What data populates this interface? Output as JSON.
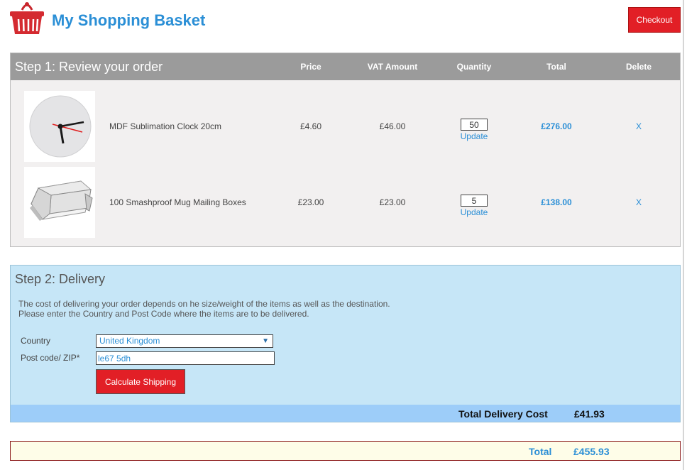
{
  "header": {
    "title": "My Shopping Basket",
    "checkout_label": "Checkout",
    "icon": "basket-icon"
  },
  "step1": {
    "title": "Step 1: Review your order",
    "columns": [
      "Price",
      "VAT Amount",
      "Quantity",
      "Total",
      "Delete"
    ],
    "items": [
      {
        "name": "MDF Sublimation Clock 20cm",
        "price": "£4.60",
        "vat": "£46.00",
        "quantity": "50",
        "update": "Update",
        "total": "£276.00",
        "delete": "X",
        "thumbnail": "clock-image"
      },
      {
        "name": "100 Smashproof Mug Mailing Boxes",
        "price": "£23.00",
        "vat": "£23.00",
        "quantity": "5",
        "update": "Update",
        "total": "£138.00",
        "delete": "X",
        "thumbnail": "mailing-box-image"
      }
    ]
  },
  "step2": {
    "title": "Step 2: Delivery",
    "desc_line1": "The cost of delivering your order depends on he size/weight of the items as well as the destination.",
    "desc_line2": "Please enter the Country and Post Code where the items are to be delivered.",
    "country_label": "Country",
    "country_value": "United Kingdom",
    "postcode_label": "Post code/ ZIP*",
    "postcode_value": "le67 5dh",
    "calc_label": "Calculate Shipping",
    "delivery_label": "Total Delivery Cost",
    "delivery_value": "£41.93"
  },
  "totals": {
    "label": "Total",
    "value": "£455.93"
  },
  "colors": {
    "accent_blue": "#2b8fd6",
    "button_red": "#e21f26",
    "step1_header": "#9b9b9b",
    "step2_bg": "#c6e6f7",
    "delivery_bar": "#9dcdf9",
    "total_bg": "#fefde8"
  }
}
